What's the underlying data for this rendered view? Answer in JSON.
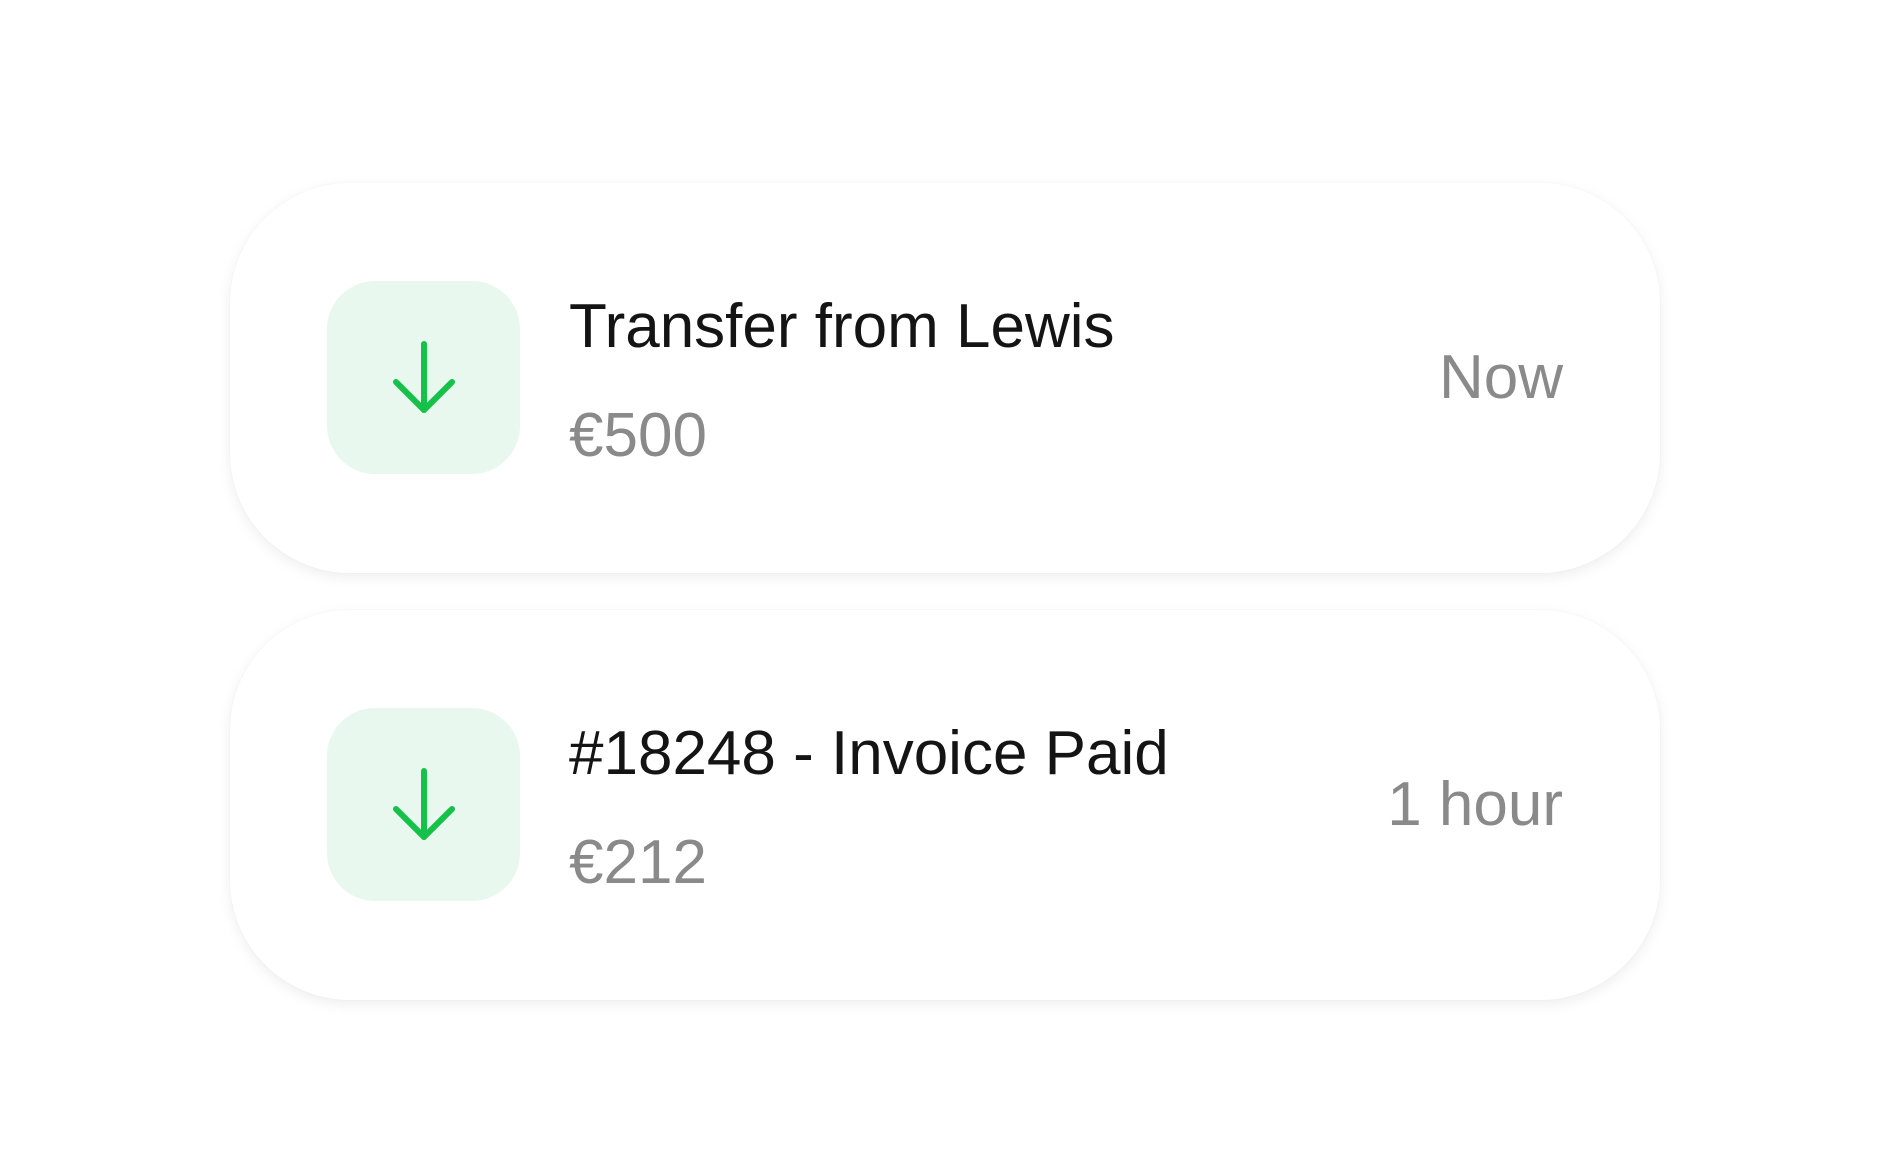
{
  "colors": {
    "accent": "#16c14a",
    "icon_background": "#e9f8ee",
    "title_text": "#141414",
    "secondary_text": "#8a8a8a",
    "card_background": "#ffffff"
  },
  "notifications": [
    {
      "icon": "arrow-down-icon",
      "title": "Transfer from Lewis",
      "amount": "€500",
      "time": "Now"
    },
    {
      "icon": "arrow-down-icon",
      "title": "#18248 - Invoice Paid",
      "amount": "€212",
      "time": "1 hour"
    }
  ]
}
